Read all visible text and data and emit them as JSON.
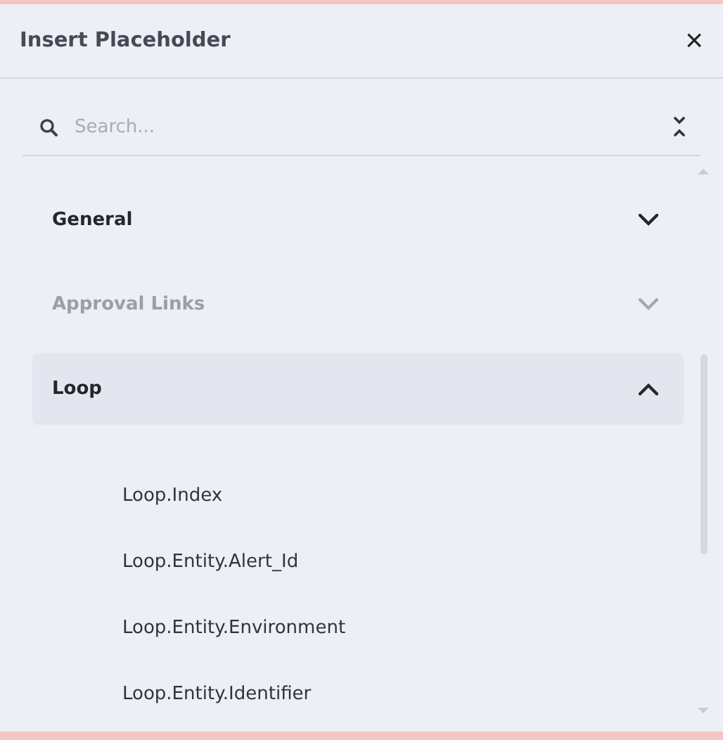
{
  "dialog": {
    "title": "Insert Placeholder",
    "close": "×"
  },
  "search": {
    "placeholder": "Search..."
  },
  "groups": [
    {
      "label": "General",
      "expanded": false,
      "disabled": false
    },
    {
      "label": "Approval Links",
      "expanded": false,
      "disabled": true
    },
    {
      "label": "Loop",
      "expanded": true,
      "disabled": false,
      "children": [
        {
          "label": "Loop.Index"
        },
        {
          "label": "Loop.Entity.Alert_Id"
        },
        {
          "label": "Loop.Entity.Environment"
        },
        {
          "label": "Loop.Entity.Identifier"
        }
      ]
    }
  ]
}
